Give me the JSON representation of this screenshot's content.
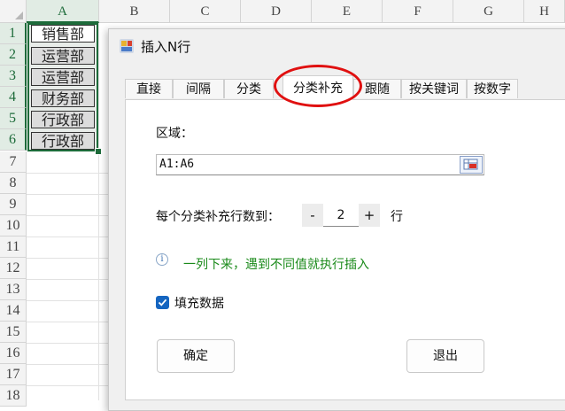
{
  "sheet": {
    "columns": [
      "A",
      "B",
      "C",
      "D",
      "E",
      "F",
      "G",
      "H"
    ],
    "rows": [
      "1",
      "2",
      "3",
      "4",
      "5",
      "6",
      "7",
      "8",
      "9",
      "10",
      "11",
      "12",
      "13",
      "14",
      "15",
      "16",
      "17",
      "18"
    ],
    "cells": [
      "销售部",
      "运营部",
      "运营部",
      "财务部",
      "行政部",
      "行政部"
    ]
  },
  "dialog": {
    "title": "插入N行",
    "tabs": [
      "直接",
      "间隔",
      "分类",
      "分类补充",
      "跟随",
      "按关键词",
      "按数字"
    ],
    "active_tab": "分类补充",
    "range_label": "区域：",
    "range_value": "A1:A6",
    "count_label": "每个分类补充行数到：",
    "count_minus": "-",
    "count_value": "2",
    "count_plus": "+",
    "count_unit": "行",
    "hint": "一列下来，遇到不同值就执行插入",
    "fill_label": "填充数据",
    "fill_checked": true,
    "ok_label": "确定",
    "exit_label": "退出"
  },
  "colors": {
    "accent_green": "#1d6b3a",
    "highlight_red": "#e01010",
    "hint_green": "#1a8a1a",
    "checkbox_blue": "#1565c0"
  }
}
